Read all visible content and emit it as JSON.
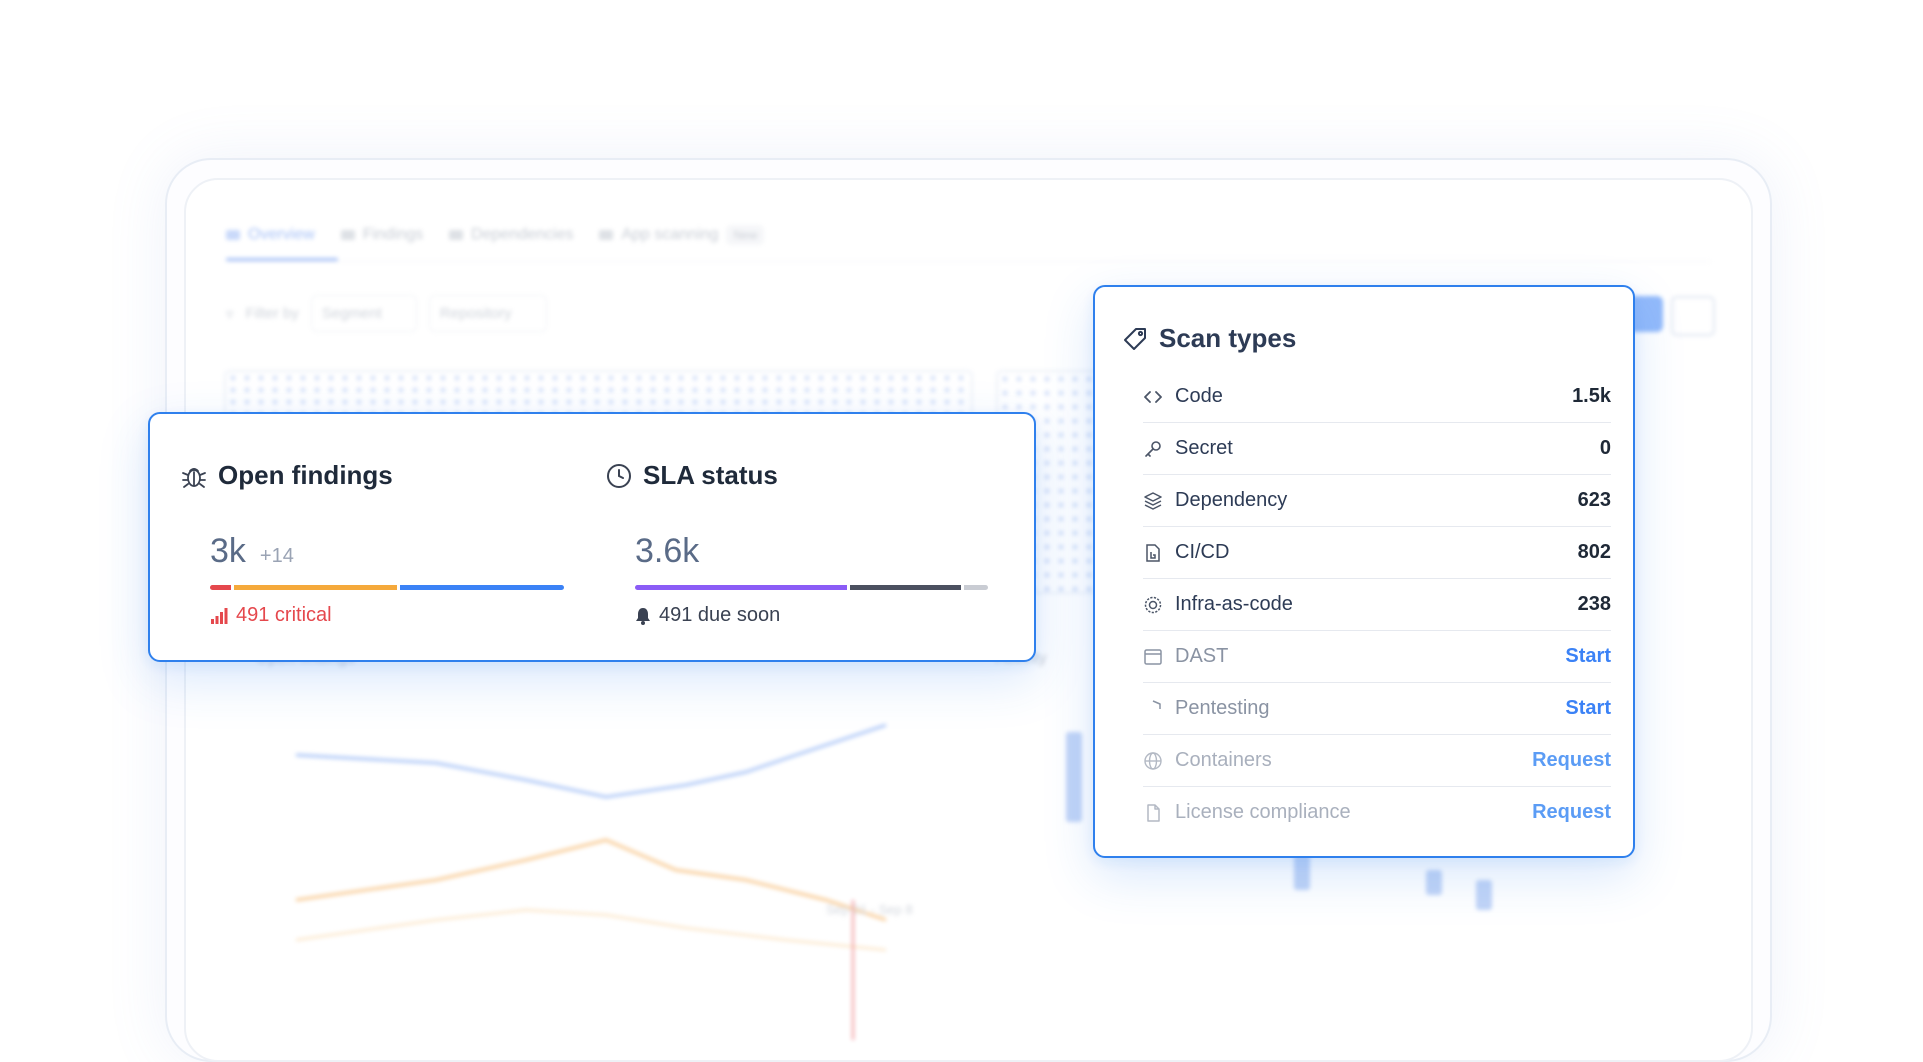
{
  "background": {
    "tabs": [
      {
        "label": "Overview",
        "active": true
      },
      {
        "label": "Findings",
        "active": false
      },
      {
        "label": "Dependencies",
        "active": false
      },
      {
        "label": "App scanning",
        "active": false
      }
    ],
    "new_badge": "New",
    "filter_label": "Filter by",
    "filters": [
      "Segment",
      "Repository"
    ],
    "chart_title": "Open findings",
    "activity_title": "Activity",
    "tooltip_text": "Sep 01 - Sep 8"
  },
  "open_findings": {
    "title": "Open findings",
    "icon": "bug-icon",
    "value": "3k",
    "delta": "+14",
    "bar_segments": [
      {
        "fraction": 0.06,
        "color": "#e5484d"
      },
      {
        "fraction": 0.47,
        "color": "#f5a93b"
      },
      {
        "fraction": 0.47,
        "color": "#3b82f6"
      }
    ],
    "footer": "491 critical",
    "footer_icon": "signal-bars-icon"
  },
  "sla_status": {
    "title": "SLA status",
    "icon": "clock-icon",
    "value": "3.6k",
    "bar_segments": [
      {
        "fraction": 0.61,
        "color": "#8b5cf6"
      },
      {
        "fraction": 0.32,
        "color": "#4b5060"
      },
      {
        "fraction": 0.07,
        "color": "#c9ccd3"
      }
    ],
    "footer": "491 due soon",
    "footer_icon": "bell-icon"
  },
  "scan_types": {
    "title": "Scan types",
    "icon": "tag-icon",
    "rows": [
      {
        "label": "Code",
        "value": "1.5k",
        "icon": "code-icon",
        "state": "active"
      },
      {
        "label": "Secret",
        "value": "0",
        "icon": "key-icon",
        "state": "active"
      },
      {
        "label": "Dependency",
        "value": "623",
        "icon": "layers-icon",
        "state": "active"
      },
      {
        "label": "CI/CD",
        "value": "802",
        "icon": "pipeline-icon",
        "state": "active"
      },
      {
        "label": "Infra-as-code",
        "value": "238",
        "icon": "cog-icon",
        "state": "active"
      },
      {
        "label": "DAST",
        "action": "Start",
        "icon": "window-icon",
        "state": "inactive"
      },
      {
        "label": "Pentesting",
        "action": "Start",
        "icon": "shield-icon",
        "state": "inactive"
      },
      {
        "label": "Containers",
        "action": "Request",
        "icon": "globe-icon",
        "state": "faded"
      },
      {
        "label": "License compliance",
        "action": "Request",
        "icon": "file-icon",
        "state": "faded"
      }
    ]
  },
  "colors": {
    "accent": "#2f80ed",
    "critical": "#e5484d",
    "link": "#3b82f6"
  }
}
